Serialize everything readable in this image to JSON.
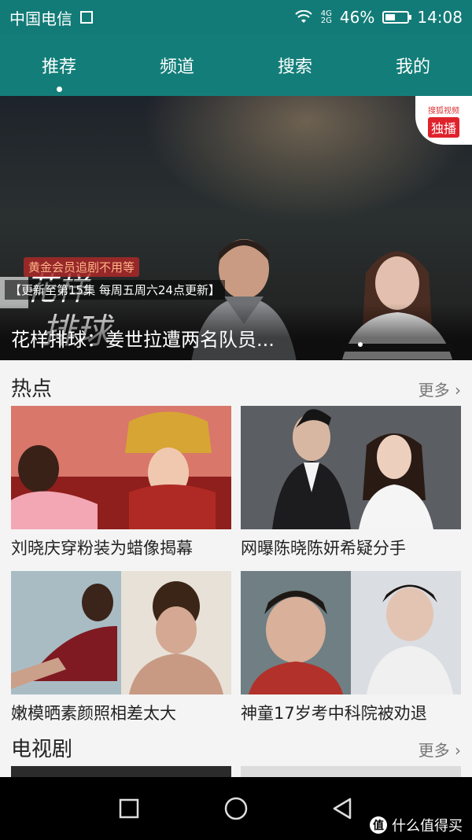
{
  "status_bar": {
    "carrier": "中国电信",
    "network_top": "4G",
    "network_bottom": "2G",
    "battery_text": "46%",
    "battery_level": 0.46,
    "time": "14:08"
  },
  "nav_tabs": [
    {
      "label": "推荐",
      "active": true
    },
    {
      "label": "频道",
      "active": false
    },
    {
      "label": "搜索",
      "active": false
    },
    {
      "label": "我的",
      "active": false
    }
  ],
  "hero": {
    "title_art_line1": "花样",
    "title_art_line2": "排球",
    "promo_tag": "黄金会员追剧不用等",
    "update_tag": "【更新至第15集 每周五周六24点更新】",
    "badge_top": "搜狐视频",
    "badge_label": "独播",
    "caption": "花样排球：姜世拉遭两名队员..."
  },
  "hot_section": {
    "title": "热点",
    "more_label": "更多",
    "items": [
      {
        "caption": "刘晓庆穿粉装为蜡像揭幕"
      },
      {
        "caption": "网曝陈晓陈妍希疑分手"
      },
      {
        "caption": "嫩模晒素颜照相差太大"
      },
      {
        "caption": "神童17岁考中科院被劝退"
      }
    ]
  },
  "tv_section": {
    "title": "电视剧",
    "more_label": "更多"
  },
  "watermark": {
    "logo": "值",
    "text": "什么值得买"
  },
  "colors": {
    "header": "#137e79",
    "accent_red": "#e0222b"
  }
}
